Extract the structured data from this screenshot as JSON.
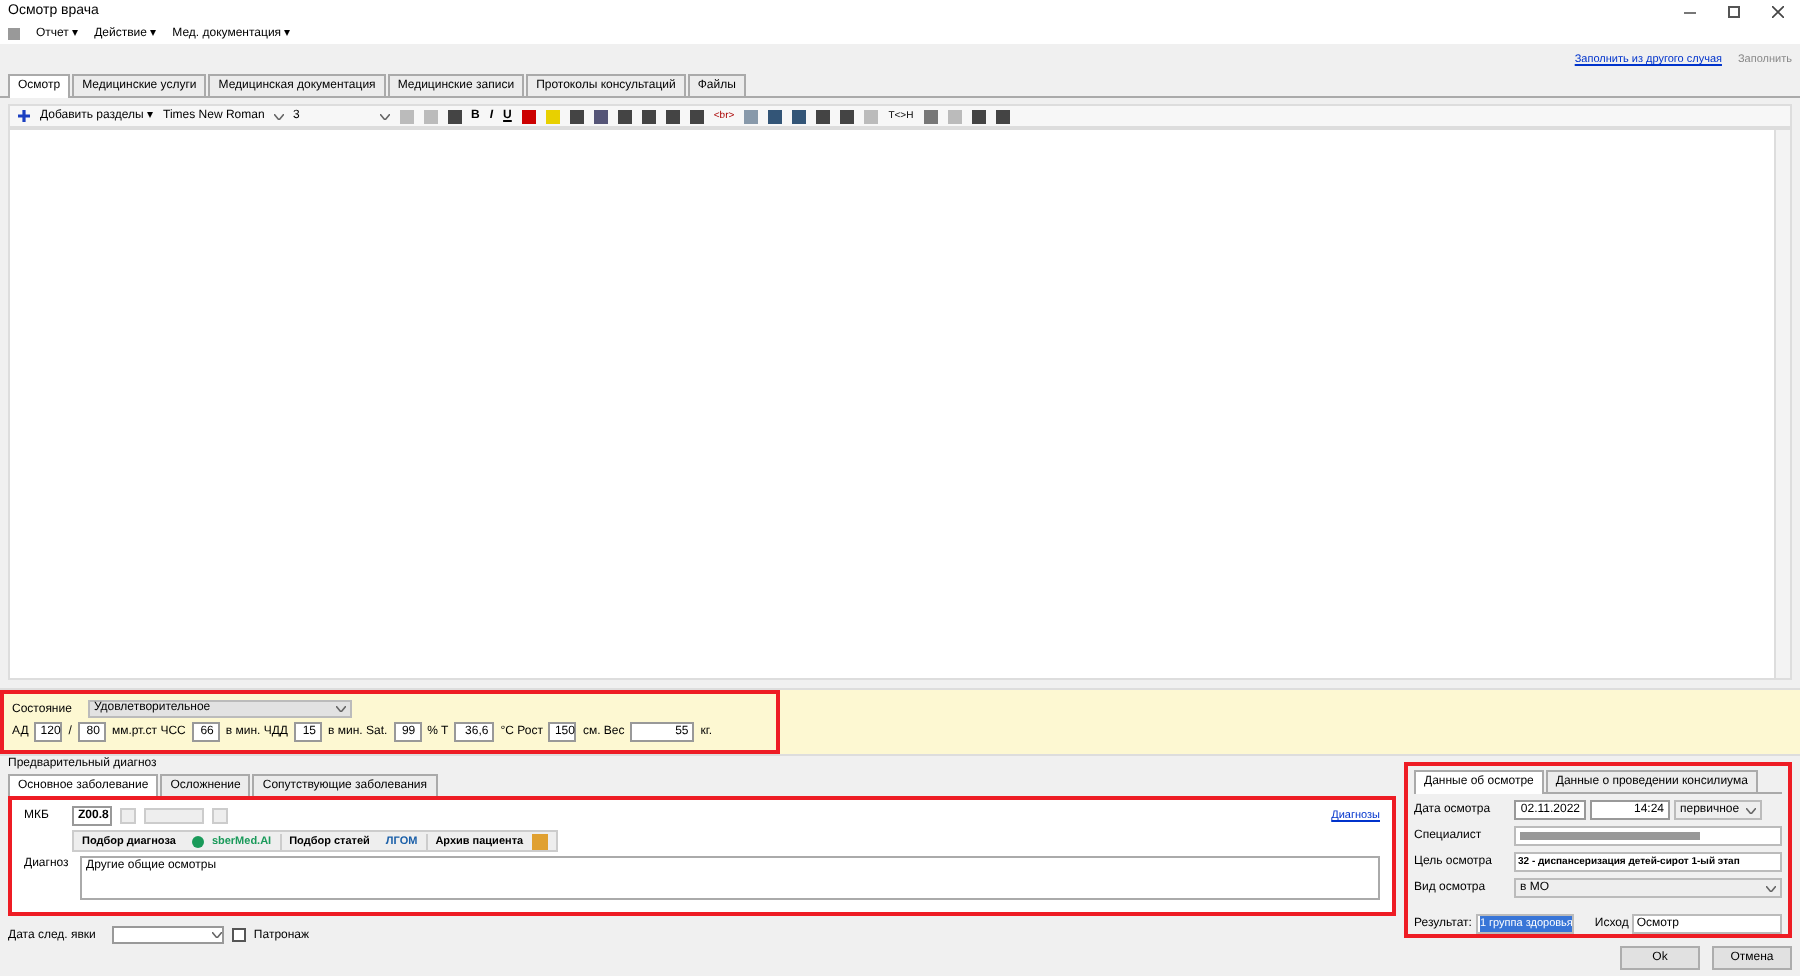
{
  "window": {
    "title": "Осмотр врача"
  },
  "menu": [
    {
      "label": "Отчет ▾"
    },
    {
      "label": "Действие ▾"
    },
    {
      "label": "Мед. документация ▾"
    }
  ],
  "links": {
    "fill_from": "Заполнить из другого случая",
    "fill": "Заполнить"
  },
  "tabs": [
    {
      "label": "Осмотр",
      "selected": true
    },
    {
      "label": "Медицинские услуги",
      "selected": false
    },
    {
      "label": "Медицинская документация",
      "selected": false
    },
    {
      "label": "Медицинские записи",
      "selected": false
    },
    {
      "label": "Протоколы консультаций",
      "selected": false
    },
    {
      "label": "Файлы",
      "selected": false
    }
  ],
  "toolbar": {
    "add_sections": "Добавить разделы ▾",
    "bold": "B",
    "italic": "I",
    "underline": "U",
    "font": "Times New Roman",
    "size": "3",
    "html": "<br>",
    "tag": "T<>H"
  },
  "vitals": {
    "state_label": "Состояние",
    "state_value": "Удовлетворительное",
    "fields": [
      {
        "label": "АД",
        "value": "120"
      },
      {
        "label": "/",
        "value": "80"
      },
      {
        "label": "мм.рт.ст  ЧСС",
        "value": "66"
      },
      {
        "label": "в мин.  ЧДД",
        "value": "15"
      },
      {
        "label": "в мин.  Sat.",
        "value": "99"
      },
      {
        "label": "%  T",
        "value": "36,6"
      },
      {
        "label": "°C  Рост",
        "value": "150"
      },
      {
        "label": "см.  Вес",
        "value": "55"
      }
    ],
    "last_unit": "кг."
  },
  "prelim_label": "Предварительный диагноз",
  "diag_tabs": [
    {
      "label": "Основное заболевание",
      "selected": true
    },
    {
      "label": "Осложнение",
      "selected": false
    },
    {
      "label": "Сопутствующие заболевания",
      "selected": false
    }
  ],
  "diag": {
    "mkb_label": "МКБ",
    "mkb_value": "Z00.8",
    "diagnoses_link": "Диагнозы",
    "buttons": [
      "Подбор диагноза",
      "Подбор статей",
      "Архив пациента"
    ],
    "logos": [
      "sberMed.AI",
      "ЛГОМ"
    ],
    "diagnosis_label": "Диагноз",
    "diagnosis_value": "Другие общие осмотры"
  },
  "next_visit": {
    "label": "Дата след. явки",
    "patronage": "Патронаж",
    "patronage_checked": false
  },
  "exam_tabs": [
    {
      "label": "Данные об осмотре",
      "selected": true
    },
    {
      "label": "Данные о проведении консилиума",
      "selected": false
    }
  ],
  "exam": {
    "date_label": "Дата осмотра",
    "date": "02.11.2022",
    "time": "14:24",
    "type": "первичное",
    "specialist_label": "Специалист",
    "goal_label": "Цель осмотра",
    "goal": "32 - диспансеризация детей-сирот 1-ый этап",
    "kind_label": "Вид осмотра",
    "kind": "в МО",
    "result_label": "Результат:",
    "result": "1 группа здоровья",
    "outcome_label": "Исход",
    "outcome": "Осмотр"
  },
  "buttons": [
    "Ok",
    "Отмена"
  ]
}
